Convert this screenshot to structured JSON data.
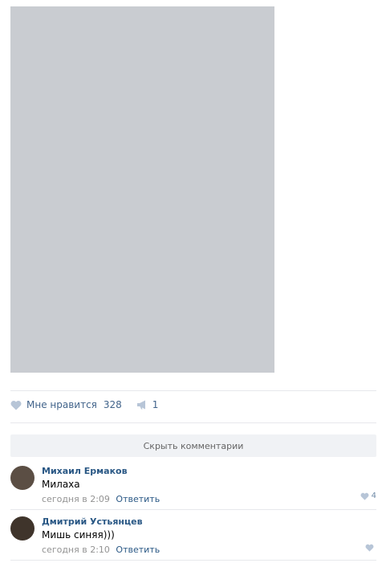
{
  "post": {
    "like_label": "Мне нравится",
    "like_count": "328",
    "share_count": "1",
    "hide_comments_label": "Скрыть комментарии"
  },
  "comments": [
    {
      "author": "Михаил Ермаков",
      "text": "Милаха",
      "time": "сегодня в 2:09",
      "reply_label": "Ответить",
      "likes": "4"
    },
    {
      "author": "Дмитрий Устьянцев",
      "text": "Мишь синяя)))",
      "time": "сегодня в 2:10",
      "reply_label": "Ответить",
      "likes": ""
    }
  ],
  "icons": {
    "like": "heart-icon",
    "share": "megaphone-icon"
  },
  "colors": {
    "link": "#2a5885",
    "divider": "#e7e8ec",
    "button_bg": "#f0f2f5",
    "meta": "#939393"
  }
}
